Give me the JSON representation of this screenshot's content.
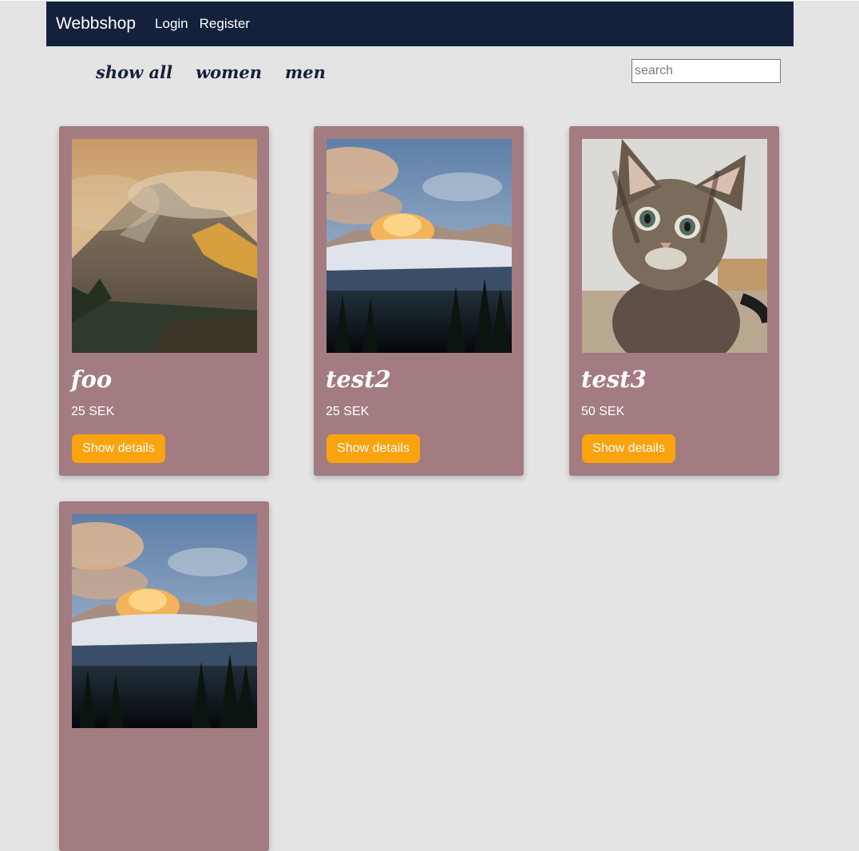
{
  "navbar": {
    "brand": "Webbshop",
    "links": [
      "Login",
      "Register"
    ]
  },
  "filters": [
    "show all",
    "women",
    "men"
  ],
  "search": {
    "placeholder": "search",
    "value": ""
  },
  "products": [
    {
      "title": "foo",
      "price": "25 SEK",
      "button_label": "Show details",
      "image": "mountain-fog-photo"
    },
    {
      "title": "test2",
      "price": "25 SEK",
      "button_label": "Show details",
      "image": "mountain-clouds-photo"
    },
    {
      "title": "test3",
      "price": "50 SEK",
      "button_label": "Show details",
      "image": "kitten-photo"
    },
    {
      "title": "",
      "price": "",
      "button_label": "",
      "image": "mountain-clouds-photo"
    }
  ],
  "colors": {
    "navbar": "#13213c",
    "page_background": "#e4e4e4",
    "card": "#a37c82",
    "button": "#f9a30f",
    "filter_text": "#13213c"
  }
}
